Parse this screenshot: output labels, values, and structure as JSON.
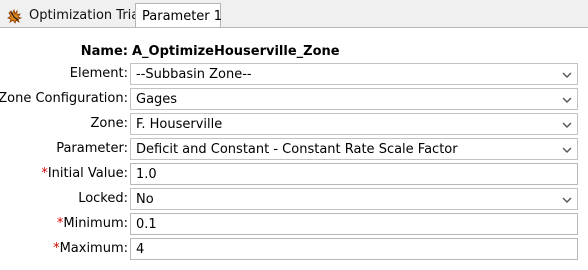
{
  "tabs": [
    {
      "label": "Optimization Trial",
      "icon": "optimization-trial-icon"
    },
    {
      "label": "Parameter 1",
      "selected": true
    }
  ],
  "form": {
    "name": {
      "label": "Name:",
      "value": "A_OptimizeHouserville_Zone"
    },
    "element": {
      "label": "Element:",
      "value": "--Subbasin Zone--"
    },
    "zone_configuration": {
      "label": "Zone Configuration:",
      "value": "Gages"
    },
    "zone": {
      "label": "Zone:",
      "value": "F. Houserville"
    },
    "parameter": {
      "label": "Parameter:",
      "value": "Deficit and Constant - Constant Rate Scale Factor"
    },
    "initial_value": {
      "required_marker": "*",
      "label": "Initial Value:",
      "value": "1.0"
    },
    "locked": {
      "label": "Locked:",
      "value": "No"
    },
    "minimum": {
      "required_marker": "*",
      "label": "Minimum:",
      "value": "0.1"
    },
    "maximum": {
      "required_marker": "*",
      "label": "Maximum:",
      "value": "4"
    }
  },
  "colors": {
    "required": "#d10000",
    "tab_background": "#f0f0f0"
  }
}
